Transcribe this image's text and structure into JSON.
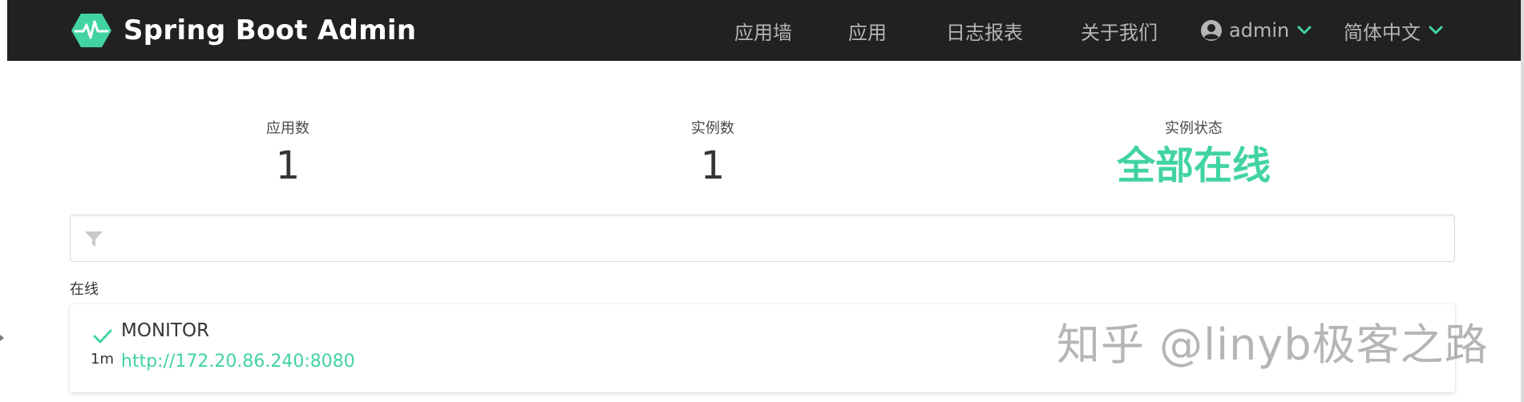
{
  "brand": {
    "title": "Spring Boot Admin",
    "logo_icon": "heartbeat-hexagon-icon",
    "accent": "#42d3a5"
  },
  "nav": {
    "wallboard": "应用墙",
    "applications": "应用",
    "journal": "日志报表",
    "about": "关于我们",
    "user": "admin",
    "language": "简体中文"
  },
  "stats": {
    "apps_label": "应用数",
    "apps_value": "1",
    "instances_label": "实例数",
    "instances_value": "1",
    "status_label": "实例状态",
    "status_value": "全部在线"
  },
  "filter": {
    "placeholder": "",
    "icon": "filter-icon"
  },
  "group": {
    "label": "在线"
  },
  "applications": [
    {
      "status_icon": "check-icon",
      "name": "MONITOR",
      "age": "1m",
      "url": "http://172.20.86.240:8080"
    }
  ],
  "watermark": "知乎 @linyb极客之路",
  "colors": {
    "navbar": "#212121",
    "nav_text": "#b5b5b5",
    "success": "#42d3a5"
  }
}
